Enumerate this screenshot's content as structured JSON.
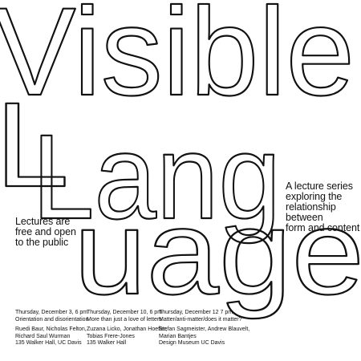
{
  "poster": {
    "title_words": [
      {
        "id": "visible",
        "text": "Visible"
      },
      {
        "id": "lang",
        "text": "Lang"
      },
      {
        "id": "uage",
        "text": "uage"
      }
    ],
    "title_hidden_letter": "L",
    "series_description": [
      "A lecture series",
      "exploring the",
      "relationship",
      "between",
      "form and content"
    ],
    "free_notice": [
      "Lectures are",
      "free and open",
      "to the public"
    ],
    "events": [
      {
        "date": "Thursday, December 3, 6 pm",
        "topic": "Orientation and disorientation",
        "speakers": [
          "Ruedi Baur, Nicholas Felton,",
          "Richard Saul Wurman"
        ],
        "location": "135 Walker Hall, UC Davis"
      },
      {
        "date": "Thursday, December 10, 6 pm",
        "topic": "More than just a love of letters",
        "speakers": [
          "Zuzana Licko, Jonathan Hoefler,",
          "Tobias Frere-Jones"
        ],
        "location": "135 Walker Hall"
      },
      {
        "date": "Thursday, December 12 7 pm,",
        "topic": "Matter/anti-matter/does it matter?",
        "speakers": [
          "Stefan Sagmeister, Andrew Blauvelt,",
          "Marian Bantjes"
        ],
        "location": "Design Museum  UC Davis"
      }
    ],
    "colors": {
      "ink": "#111111",
      "paper": "#ffffff"
    }
  }
}
